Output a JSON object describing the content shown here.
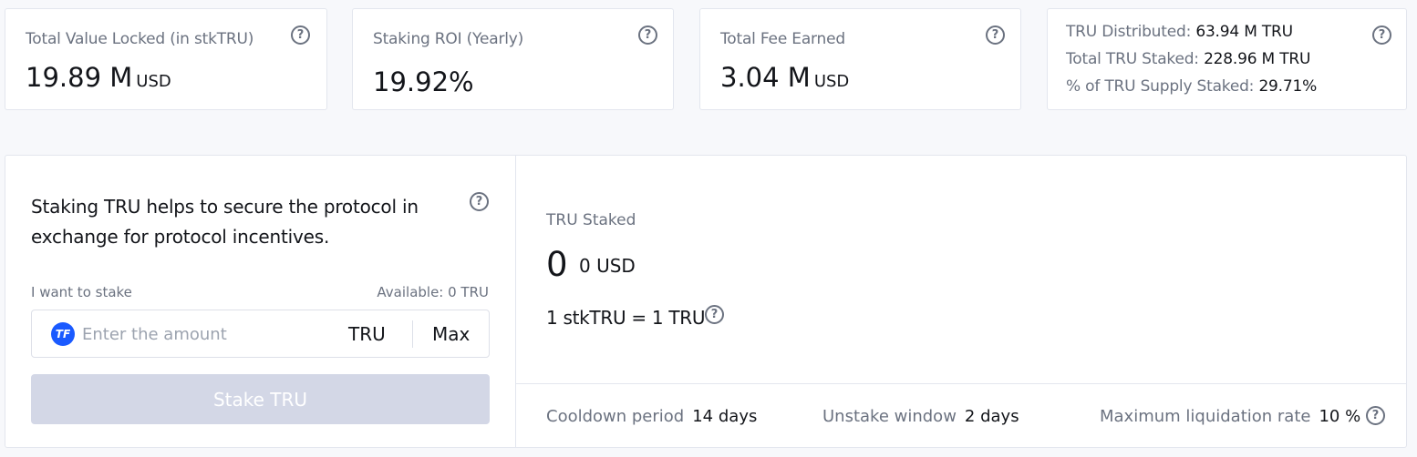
{
  "stats": {
    "tvl": {
      "label": "Total Value Locked (in stkTRU)",
      "value": "19.89 M",
      "unit": "USD"
    },
    "roi": {
      "label": "Staking ROI (Yearly)",
      "value": "19.92%"
    },
    "fee": {
      "label": "Total Fee Earned",
      "value": "3.04 M",
      "unit": "USD"
    },
    "distribution": {
      "distributed_label": "TRU Distributed:",
      "distributed_value": "63.94 M  TRU",
      "staked_label": "Total TRU Staked:",
      "staked_value": "228.96 M TRU",
      "supply_label": "% of TRU Supply Staked:",
      "supply_value": "29.71%"
    }
  },
  "stake": {
    "intro": "Staking TRU helps to secure the protocol in exchange for protocol incentives.",
    "want_label": "I want to stake",
    "available": "Available: 0 TRU",
    "token_icon": "TrueFi",
    "input_placeholder": "Enter the amount",
    "input_value": "",
    "unit": "TRU",
    "max_label": "Max",
    "button_label": "Stake TRU"
  },
  "staked": {
    "label": "TRU Staked",
    "value": "0",
    "usd": "0 USD",
    "rate": "1 stkTRU = 1 TRU"
  },
  "footer": {
    "cooldown_label": "Cooldown period",
    "cooldown_value": "14 days",
    "unstake_label": "Unstake window",
    "unstake_value": "2 days",
    "liquidation_label": "Maximum liquidation rate",
    "liquidation_value": "10 %"
  },
  "icons": {
    "help": "?"
  },
  "colors": {
    "accent": "#1a5aff",
    "muted": "#6b7280",
    "button_disabled": "#d3d7e6"
  }
}
